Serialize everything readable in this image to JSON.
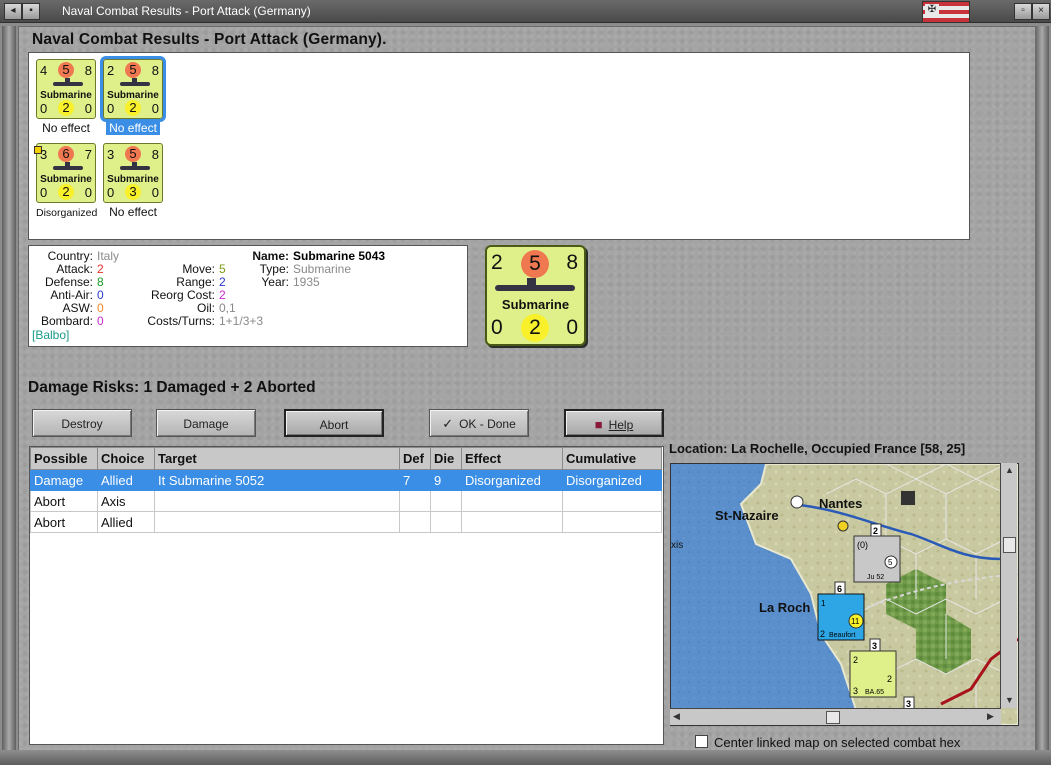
{
  "window": {
    "title": "Naval Combat Results - Port Attack (Germany)"
  },
  "header": {
    "title": "Naval Combat Results - Port Attack (Germany)."
  },
  "units": [
    {
      "tl": "4",
      "tc": "5",
      "tr": "8",
      "label": "Submarine",
      "bl": "0",
      "bc": "2",
      "br": "0",
      "status": "No effect"
    },
    {
      "tl": "2",
      "tc": "5",
      "tr": "8",
      "label": "Submarine",
      "bl": "0",
      "bc": "2",
      "br": "0",
      "status": "No effect"
    },
    {
      "tl": "3",
      "tc": "6",
      "tr": "7",
      "label": "Submarine",
      "bl": "0",
      "bc": "2",
      "br": "0",
      "status": "Disorganized"
    },
    {
      "tl": "3",
      "tc": "5",
      "tr": "8",
      "label": "Submarine",
      "bl": "0",
      "bc": "3",
      "br": "0",
      "status": "No effect"
    }
  ],
  "info": {
    "country_label": "Country:",
    "country": "Italy",
    "attack_label": "Attack:",
    "attack": "2",
    "defense_label": "Defense:",
    "defense": "8",
    "antiair_label": "Anti-Air:",
    "antiair": "0",
    "asw_label": "ASW:",
    "asw": "0",
    "bombard_label": "Bombard:",
    "bombard": "0",
    "leader": "[Balbo]",
    "move_label": "Move:",
    "move": "5",
    "range_label": "Range:",
    "range": "2",
    "reorg_label": "Reorg Cost:",
    "reorg": "2",
    "oil_label": "Oil:",
    "oil": "0,1",
    "costs_label": "Costs/Turns:",
    "costs": "1+1/3+3",
    "name_label": "Name:",
    "name": "Submarine 5043",
    "type_label": "Type:",
    "type": "Submarine",
    "year_label": "Year:",
    "year": "1935"
  },
  "big_counter": {
    "tl": "2",
    "tc": "5",
    "tr": "8",
    "label": "Submarine",
    "bl": "0",
    "bc": "2",
    "br": "0"
  },
  "damage_risks": "Damage Risks:  1 Damaged + 2 Aborted",
  "buttons": {
    "destroy": "Destroy",
    "damage": "Damage",
    "abort": "Abort",
    "ok": "OK - Done",
    "help": "Help"
  },
  "table": {
    "headers": [
      "Possible",
      "Choice",
      "Target",
      "Def",
      "Die",
      "Effect",
      "Cumulative"
    ],
    "rows": [
      [
        "Damage",
        "Allied",
        "It Submarine 5052",
        "7",
        "9",
        "Disorganized",
        "Disorganized"
      ],
      [
        "Abort",
        "Axis",
        "",
        "",
        "",
        "",
        ""
      ],
      [
        "Abort",
        "Allied",
        "",
        "",
        "",
        "",
        ""
      ]
    ]
  },
  "location": "Location:  La Rochelle, Occupied France [58, 25]",
  "map": {
    "places": [
      "Nantes",
      "St-Nazaire",
      "La Roch"
    ],
    "units": [
      {
        "name": "Ju 52",
        "a": "(0)",
        "b": "5"
      },
      {
        "name": "Beaufort",
        "a": "1",
        "b": "11",
        "c": "2"
      },
      {
        "name": "BA.65",
        "a": "2",
        "b": "2",
        "c": "3"
      }
    ],
    "stack_counts": [
      "2",
      "6",
      "3",
      "3"
    ],
    "edge_text": "xis"
  },
  "checkbox": {
    "label": "Center linked map on selected combat hex",
    "checked": false
  }
}
